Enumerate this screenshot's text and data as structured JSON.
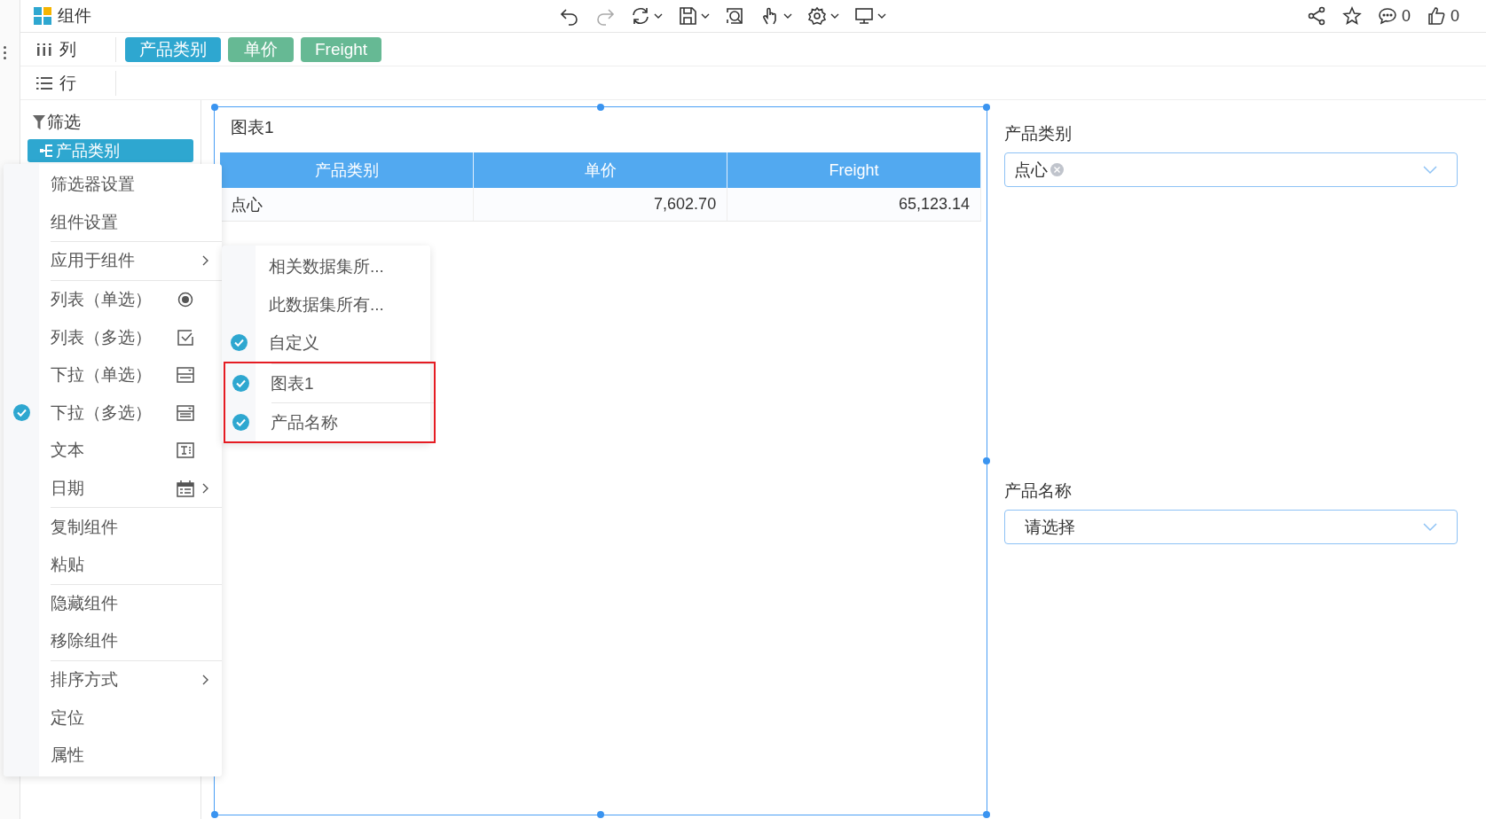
{
  "header": {
    "title": "组件",
    "comment_count": "0",
    "like_count": "0"
  },
  "fields": {
    "columns": {
      "label": "列",
      "pills": [
        {
          "text": "产品类别",
          "color": "#2ea7d0"
        },
        {
          "text": "单价",
          "color": "#66b994"
        },
        {
          "text": "Freight",
          "color": "#66b994"
        }
      ]
    },
    "rows": {
      "label": "行"
    }
  },
  "filter_panel": {
    "title": "筛选",
    "items": [
      {
        "label": "产品类别",
        "selected": true
      }
    ]
  },
  "chart": {
    "title": "图表1",
    "columns": [
      "产品类别",
      "单价",
      "Freight"
    ],
    "rows": [
      [
        "点心",
        "7,602.70",
        "65,123.14"
      ]
    ]
  },
  "filters": [
    {
      "label": "产品类别",
      "tags": [
        "点心"
      ]
    },
    {
      "label": "产品名称",
      "placeholder": "请选择"
    }
  ],
  "context_menu": {
    "groups": [
      [
        {
          "label": "筛选器设置",
          "kind": "plain",
          "checked": false,
          "submenu": false
        },
        {
          "label": "组件设置",
          "kind": "plain",
          "checked": false,
          "submenu": false
        }
      ],
      [
        {
          "label": "应用于组件",
          "kind": "plain",
          "checked": false,
          "submenu": true
        }
      ],
      [
        {
          "label": "列表（单选）",
          "kind": "list-single",
          "checked": false,
          "submenu": false
        },
        {
          "label": "列表（多选）",
          "kind": "list-multi",
          "checked": false,
          "submenu": false
        },
        {
          "label": "下拉（单选）",
          "kind": "dropdown-single",
          "checked": false,
          "submenu": false
        },
        {
          "label": "下拉（多选）",
          "kind": "dropdown-multi",
          "checked": true,
          "submenu": false
        },
        {
          "label": "文本",
          "kind": "text",
          "checked": false,
          "submenu": false
        },
        {
          "label": "日期",
          "kind": "date",
          "checked": false,
          "submenu": true
        }
      ],
      [
        {
          "label": "复制组件",
          "kind": "plain",
          "checked": false,
          "submenu": false
        },
        {
          "label": "粘贴",
          "kind": "plain",
          "checked": false,
          "submenu": false
        }
      ],
      [
        {
          "label": "隐藏组件",
          "kind": "plain",
          "checked": false,
          "submenu": false
        },
        {
          "label": "移除组件",
          "kind": "plain",
          "checked": false,
          "submenu": false
        }
      ],
      [
        {
          "label": "排序方式",
          "kind": "plain",
          "checked": false,
          "submenu": true
        },
        {
          "label": "定位",
          "kind": "plain",
          "checked": false,
          "submenu": false
        },
        {
          "label": "属性",
          "kind": "plain",
          "checked": false,
          "submenu": false
        }
      ]
    ]
  },
  "submenu": {
    "groups": [
      {
        "highlighted": false,
        "items": [
          {
            "label": "相关数据集所...",
            "checked": false
          },
          {
            "label": "此数据集所有...",
            "checked": false
          },
          {
            "label": "自定义",
            "checked": true
          }
        ]
      },
      {
        "highlighted": true,
        "items": [
          {
            "label": "图表1",
            "checked": true
          },
          {
            "label": "产品名称",
            "checked": true
          }
        ]
      }
    ]
  }
}
